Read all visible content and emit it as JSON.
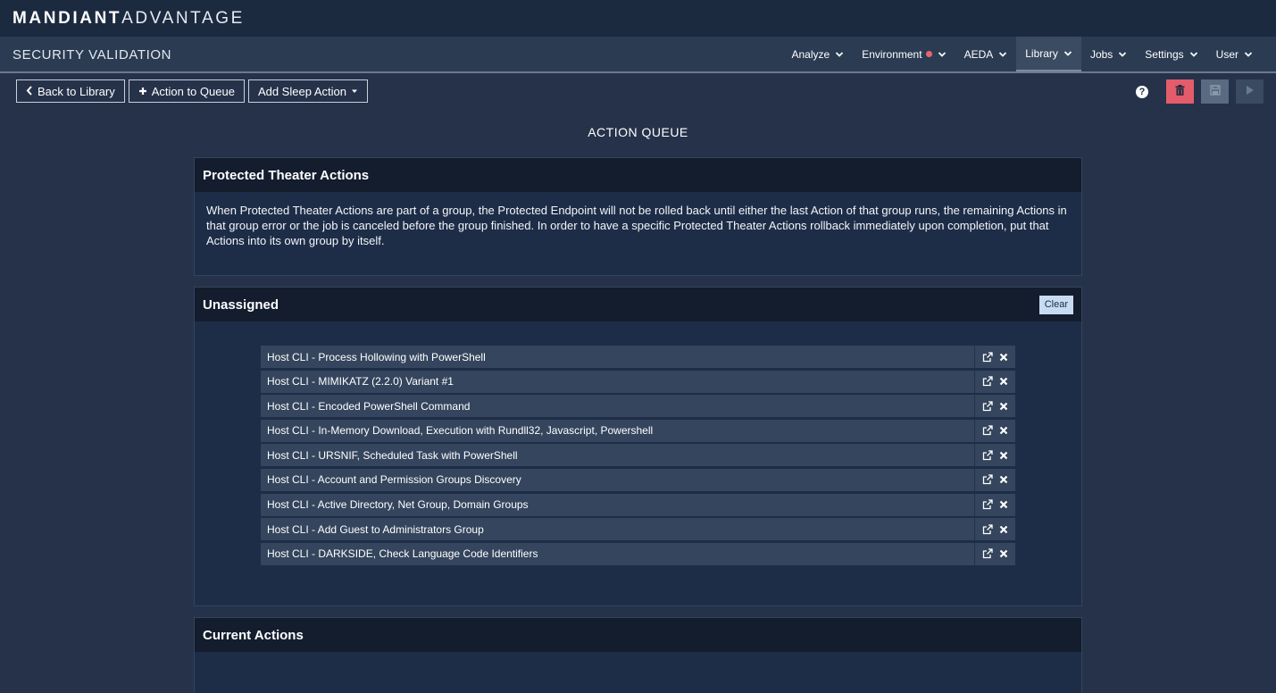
{
  "brand": {
    "part1": "MANDIANT",
    "part2": "ADVANTAGE"
  },
  "app": {
    "title": "SECURITY VALIDATION"
  },
  "nav": {
    "items": [
      {
        "label": "Analyze"
      },
      {
        "label": "Environment"
      },
      {
        "label": "AEDA"
      },
      {
        "label": "Library"
      },
      {
        "label": "Jobs"
      },
      {
        "label": "Settings"
      },
      {
        "label": "User"
      }
    ],
    "active": "Library"
  },
  "toolbar": {
    "back_label": "Back to Library",
    "add_queue_label": "Action to Queue",
    "sleep_label": "Add Sleep Action"
  },
  "tools": {
    "help": "?"
  },
  "heading": "ACTION QUEUE",
  "protected": {
    "title": "Protected Theater Actions",
    "text": "When Protected Theater Actions are part of a group, the Protected Endpoint will not be rolled back until either the last Action of that group runs, the remaining Actions in that group error or the job is canceled before the group finished. In order to have a specific Protected Theater Actions rollback immediately upon completion, put that Actions into its own group by itself."
  },
  "unassigned": {
    "title": "Unassigned",
    "clear_label": "Clear",
    "actions": [
      {
        "name": "Host CLI - Process Hollowing with PowerShell"
      },
      {
        "name": "Host CLI - MIMIKATZ (2.2.0) Variant #1"
      },
      {
        "name": "Host CLI - Encoded PowerShell Command"
      },
      {
        "name": "Host CLI - In-Memory Download, Execution with Rundll32, Javascript, Powershell"
      },
      {
        "name": "Host CLI - URSNIF, Scheduled Task with PowerShell"
      },
      {
        "name": "Host CLI - Account and Permission Groups Discovery"
      },
      {
        "name": "Host CLI - Active Directory, Net Group, Domain Groups"
      },
      {
        "name": "Host CLI - Add Guest to Administrators Group"
      },
      {
        "name": "Host CLI - DARKSIDE, Check Language Code Identifiers"
      }
    ]
  },
  "current": {
    "title": "Current Actions"
  },
  "colors": {
    "background": "#25324a",
    "header": "#1c2a40",
    "accent_delete": "#e45c6a",
    "status_dot": "#e8656f",
    "clear_button": "#c7dcf2"
  }
}
